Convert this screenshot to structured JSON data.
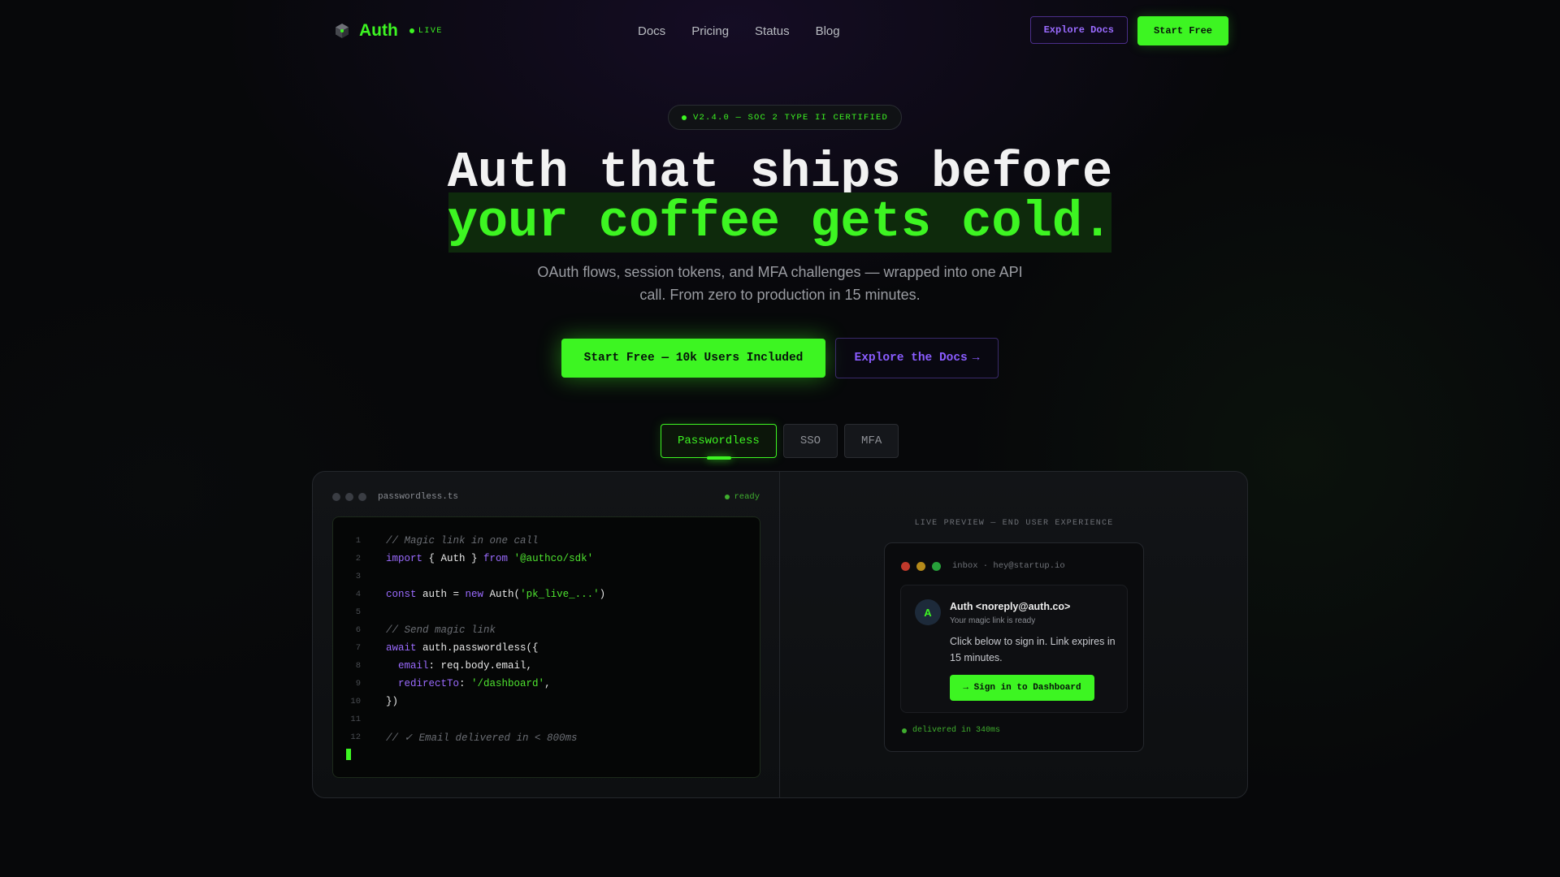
{
  "nav": {
    "brand": "Auth",
    "live": "LIVE",
    "links": [
      "Docs",
      "Pricing",
      "Status",
      "Blog"
    ],
    "explore_docs": "Explore Docs",
    "start_free": "Start Free"
  },
  "hero": {
    "badge": "V2.4.0 — SOC 2 TYPE II CERTIFIED",
    "title_line1": "Auth that ships before",
    "title_line2": "your coffee gets cold.",
    "subtitle": "OAuth flows, session tokens, and MFA challenges — wrapped into one API call. From zero to production in 15 minutes.",
    "cta_primary": "Start Free — 10k Users Included",
    "cta_secondary": "Explore the Docs",
    "cta_secondary_arrow": "→"
  },
  "tabs": [
    {
      "label": "Passwordless",
      "active": true
    },
    {
      "label": "SSO",
      "active": false
    },
    {
      "label": "MFA",
      "active": false
    }
  ],
  "editor": {
    "filename": "passwordless.ts",
    "status": "ready",
    "lines": [
      {
        "n": "1",
        "tokens": [
          {
            "t": "// Magic link in one call",
            "c": "cm"
          }
        ]
      },
      {
        "n": "2",
        "tokens": [
          {
            "t": "import",
            "c": "kw"
          },
          {
            "t": " { Auth } ",
            "c": ""
          },
          {
            "t": "from",
            "c": "kw"
          },
          {
            "t": " ",
            "c": ""
          },
          {
            "t": "'@authco/sdk'",
            "c": "str"
          }
        ]
      },
      {
        "n": "3",
        "tokens": []
      },
      {
        "n": "4",
        "tokens": [
          {
            "t": "const",
            "c": "kw"
          },
          {
            "t": " auth = ",
            "c": ""
          },
          {
            "t": "new",
            "c": "kw"
          },
          {
            "t": " Auth(",
            "c": ""
          },
          {
            "t": "'pk_live_...'",
            "c": "str"
          },
          {
            "t": ")",
            "c": ""
          }
        ]
      },
      {
        "n": "5",
        "tokens": []
      },
      {
        "n": "6",
        "tokens": [
          {
            "t": "// Send magic link",
            "c": "cm"
          }
        ]
      },
      {
        "n": "7",
        "tokens": [
          {
            "t": "await",
            "c": "kw"
          },
          {
            "t": " auth.passwordless({",
            "c": ""
          }
        ]
      },
      {
        "n": "8",
        "tokens": [
          {
            "t": "  ",
            "c": ""
          },
          {
            "t": "email",
            "c": "prop"
          },
          {
            "t": ": req.body.email,",
            "c": ""
          }
        ]
      },
      {
        "n": "9",
        "tokens": [
          {
            "t": "  ",
            "c": ""
          },
          {
            "t": "redirectTo",
            "c": "prop"
          },
          {
            "t": ": ",
            "c": ""
          },
          {
            "t": "'/dashboard'",
            "c": "str"
          },
          {
            "t": ",",
            "c": ""
          }
        ]
      },
      {
        "n": "10",
        "tokens": [
          {
            "t": "})",
            "c": ""
          }
        ]
      },
      {
        "n": "11",
        "tokens": []
      },
      {
        "n": "12",
        "tokens": [
          {
            "t": "// ✓ Email delivered in < 800ms",
            "c": "cm"
          }
        ]
      }
    ]
  },
  "preview": {
    "label": "LIVE PREVIEW — END USER EXPERIENCE",
    "inbox": "inbox · hey@startup.io",
    "avatar": "A",
    "from": "Auth <noreply@auth.co>",
    "subject": "Your magic link is ready",
    "body": "Click below to sign in. Link expires in 15 minutes.",
    "button": "→ Sign in to Dashboard",
    "delivered": "delivered in 340ms"
  },
  "colors": {
    "accent": "#3df522",
    "purple": "#9b6bff",
    "background": "#07080a"
  }
}
